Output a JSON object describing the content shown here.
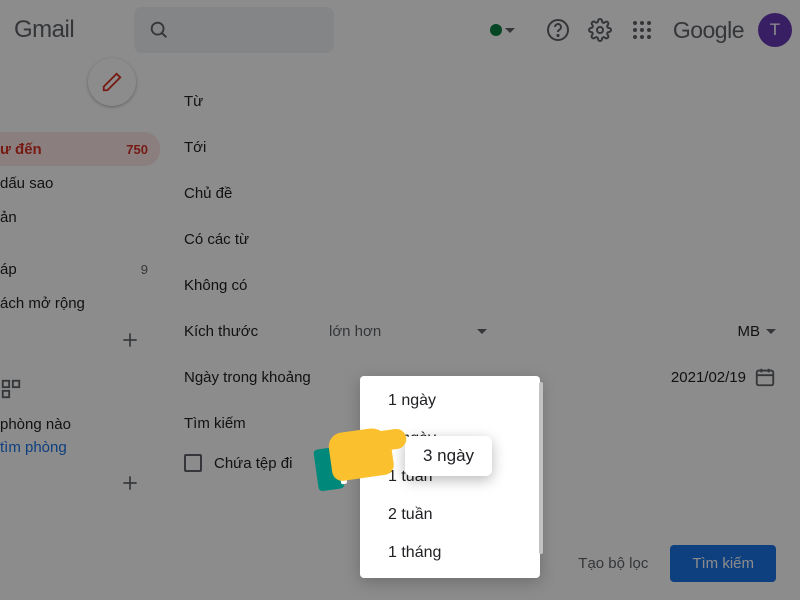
{
  "header": {
    "logo": "Gmail",
    "google": "Google",
    "avatar_initial": "T"
  },
  "sidebar": {
    "items": [
      {
        "label": "ư đến",
        "count": "750",
        "active": true
      },
      {
        "label": "dấu sao",
        "count": ""
      },
      {
        "label": "ản",
        "count": ""
      },
      {
        "label": "áp",
        "count": "9"
      },
      {
        "label": "ách mở rộng",
        "count": ""
      }
    ],
    "meet_line1": "phòng nào",
    "meet_line2": "tìm phòng"
  },
  "form": {
    "from": "Từ",
    "to": "Tới",
    "subject": "Chủ đề",
    "has_words": "Có các từ",
    "not_have": "Không có",
    "size": "Kích thước",
    "size_op": "lớn hơn",
    "size_unit": "MB",
    "date_within": "Ngày trong khoảng",
    "date_value": "2021/02/19",
    "search": "Tìm kiếm",
    "has_attachment": "Chứa tệp đi",
    "create_filter": "Tạo bộ lọc",
    "search_btn": "Tìm kiếm"
  },
  "dropdown": {
    "options": [
      "1 ngày",
      "3 ngày",
      "1 tuần",
      "2 tuần",
      "1 tháng"
    ],
    "selected": "3 ngày"
  }
}
